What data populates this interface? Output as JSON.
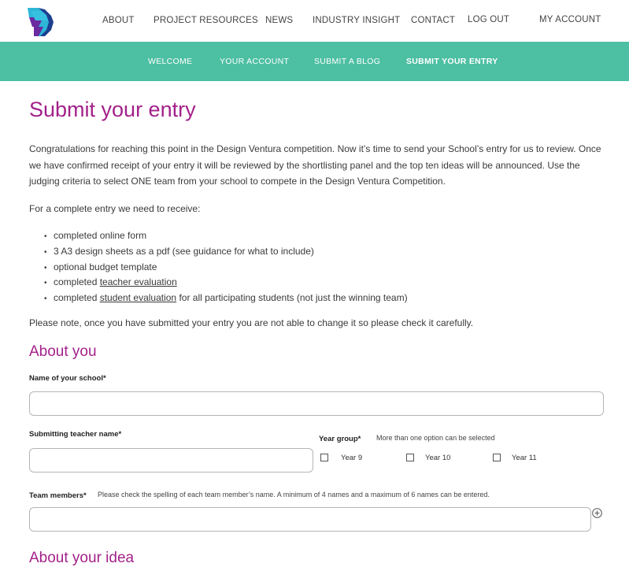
{
  "header": {
    "nav": [
      {
        "label": "ABOUT"
      },
      {
        "label": "PROJECT RESOURCES"
      },
      {
        "label": "NEWS"
      },
      {
        "label": "INDUSTRY INSIGHT"
      },
      {
        "label": "CONTACT"
      },
      {
        "label": "LOG OUT"
      },
      {
        "label": "MY ACCOUNT"
      }
    ],
    "logo_icon": "design-ventura-logo-icon"
  },
  "subnav": {
    "items": [
      {
        "label": "WELCOME"
      },
      {
        "label": "YOUR ACCOUNT"
      },
      {
        "label": "SUBMIT A BLOG"
      },
      {
        "label": "SUBMIT YOUR ENTRY",
        "active": true
      }
    ],
    "bg_color": "#4dbfa3"
  },
  "main": {
    "title": "Submit your entry",
    "intro": "Congratulations for reaching this point in the Design Ventura competition. Now it’s time to send your School’s entry for us to review. Once we have confirmed receipt of your entry it will be reviewed by the shortlisting panel and the top ten ideas will be announced. Use the judging criteria to select ONE team from your school to compete in the Design Ventura Competition.",
    "requirements_intro": "For a complete entry we need to receive:",
    "requirements": {
      "item1": "completed online form",
      "item2": "3 A3 design sheets as a pdf (see guidance for what to include)",
      "item3": "optional budget template",
      "item4_prefix": "completed ",
      "item4_link": "teacher evaluation",
      "item5_prefix": "completed ",
      "item5_link": "student evaluation",
      "item5_suffix": " for all participating students (not just the winning team)"
    },
    "note": "Please note, once you have submitted your entry you are not able to change it so please check it carefully.",
    "accent_color": "#a3218a"
  },
  "form": {
    "about_you_heading": "About you",
    "school_label": "Name of your school*",
    "school_value": "",
    "teacher_label": "Submitting teacher name*",
    "teacher_value": "",
    "year_group_label": "Year group*",
    "year_group_note": "More than one option can be selected",
    "year_options": [
      {
        "label": "Year 9",
        "checked": false
      },
      {
        "label": "Year 10",
        "checked": false
      },
      {
        "label": "Year 11",
        "checked": false
      }
    ],
    "team_label": "Team members*",
    "team_note": "Please check the spelling of each team member’s name. A minimum of 4 names and a maximum of 6 names can be entered.",
    "team_value": "",
    "add_icon": "plus-circle-icon",
    "about_idea_heading": "About your idea"
  }
}
